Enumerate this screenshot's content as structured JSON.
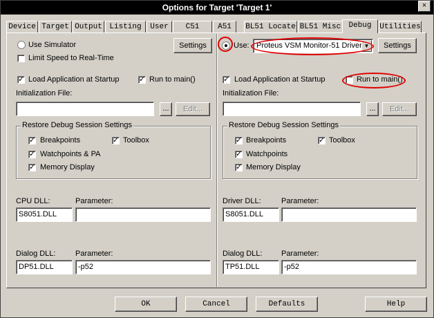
{
  "window": {
    "title": "Options for Target 'Target 1'",
    "close_glyph": "×"
  },
  "tabs": [
    "Device",
    "Target",
    "Output",
    "Listing",
    "User",
    "C51",
    "A51",
    "BL51 Locate",
    "BL51 Misc",
    "Debug",
    "Utilities"
  ],
  "active_tab": "Debug",
  "left": {
    "use_simulator": "Use Simulator",
    "limit_speed": "Limit Speed to Real-Time",
    "settings": "Settings",
    "load_app": "Load Application at Startup",
    "run_to_main": "Run to main()",
    "init_file_label": "Initialization File:",
    "init_file_value": "",
    "browse": "...",
    "edit": "Edit...",
    "restore_group": "Restore Debug Session Settings",
    "breakpoints": "Breakpoints",
    "toolbox": "Toolbox",
    "watchpoints": "Watchpoints & PA",
    "memory_display": "Memory Display",
    "cpu_dll_label": "CPU DLL:",
    "cpu_dll_value": "S8051.DLL",
    "cpu_param_label": "Parameter:",
    "cpu_param_value": "",
    "dialog_dll_label": "Dialog DLL:",
    "dialog_dll_value": "DP51.DLL",
    "dialog_param_label": "Parameter:",
    "dialog_param_value": "-p52"
  },
  "right": {
    "use_label": "Use:",
    "driver": "Proteus VSM Monitor-51 Driver",
    "settings": "Settings",
    "load_app": "Load Application at Startup",
    "run_to_main": "Run to main()",
    "init_file_label": "Initialization File:",
    "init_file_value": "",
    "browse": "...",
    "edit": "Edit...",
    "restore_group": "Restore Debug Session Settings",
    "breakpoints": "Breakpoints",
    "toolbox": "Toolbox",
    "watchpoints": "Watchpoints",
    "memory_display": "Memory Display",
    "driver_dll_label": "Driver DLL:",
    "driver_dll_value": "S8051.DLL",
    "driver_param_label": "Parameter:",
    "driver_param_value": "",
    "dialog_dll_label": "Dialog DLL:",
    "dialog_dll_value": "TP51.DLL",
    "dialog_param_label": "Parameter:",
    "dialog_param_value": "-p52"
  },
  "footer": {
    "ok": "OK",
    "cancel": "Cancel",
    "defaults": "Defaults",
    "help": "Help"
  },
  "colors": {
    "face": "#d4d0c8",
    "annotation": "#e00000",
    "title_bg": "#000000"
  }
}
